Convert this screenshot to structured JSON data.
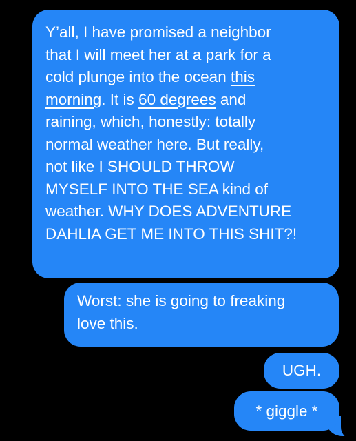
{
  "thread": {
    "bubble_color": "#2586F7",
    "text_color": "#FFFFFF",
    "background": "#000000",
    "messages": [
      {
        "sender": "me",
        "lines": [
          [
            "Y’all, I have promised a neighbor"
          ],
          [
            "that I will meet her at a park for a"
          ],
          [
            "cold plunge into the ocean ",
            "this"
          ],
          [
            "morning",
            ". It is ",
            "60 degrees",
            " and"
          ],
          [
            "raining, which, honestly: totally"
          ],
          [
            "normal weather here. But really,"
          ],
          [
            "not like I SHOULD THROW"
          ],
          [
            "MYSELF INTO THE SEA kind of"
          ],
          [
            "weather. WHY DOES ADVENTURE"
          ],
          [
            "DAHLIA GET ME INTO THIS SHIT?!"
          ]
        ],
        "links": [
          "this morning",
          "60 degrees"
        ]
      },
      {
        "sender": "me",
        "lines": [
          [
            "Worst: she is going to freaking"
          ],
          [
            "love this."
          ]
        ]
      },
      {
        "sender": "me",
        "lines": [
          [
            "UGH."
          ]
        ]
      },
      {
        "sender": "me",
        "lines": [
          [
            "* giggle *"
          ]
        ]
      }
    ]
  }
}
